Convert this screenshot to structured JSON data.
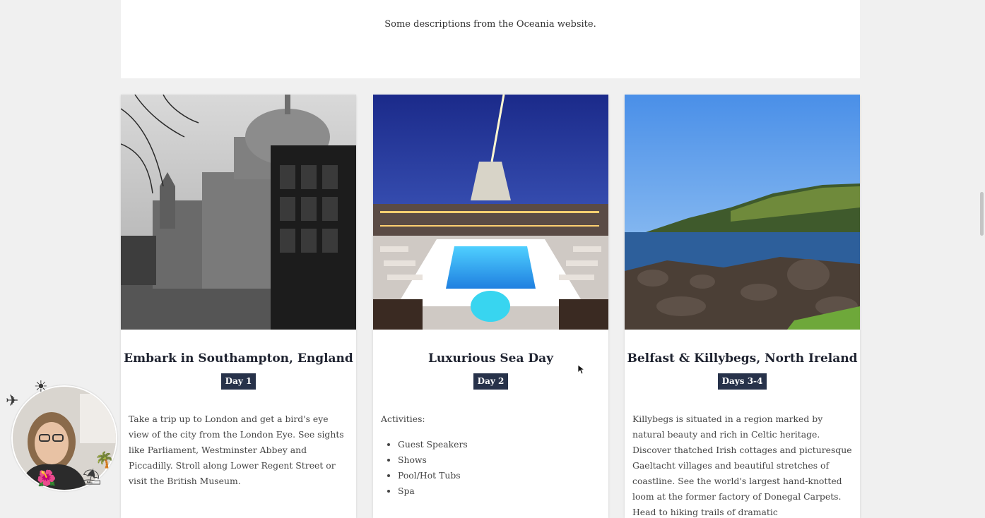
{
  "intro": {
    "text": "Some descriptions from the Oceania website."
  },
  "cards": [
    {
      "title": "Embark in Southampton, England",
      "day": "Day 1",
      "image_icon": "st-pauls-cathedral-photo",
      "body": "Take a trip up to London and get a bird's eye view of the city from the London Eye. See sights like Parliament, Westminster Abbey and Piccadilly. Stroll along Lower Regent Street or visit the British Museum."
    },
    {
      "title": "Luxurious Sea Day",
      "day": "Day 2",
      "image_icon": "cruise-ship-pool-deck-photo",
      "intro": "Activities:",
      "activities": [
        "Guest Speakers",
        "Shows",
        "Pool/Hot Tubs",
        "Spa"
      ]
    },
    {
      "title": "Belfast & Killybegs, North Ireland",
      "day": "Days 3-4",
      "image_icon": "coastal-cliffs-photo",
      "body": "Killybegs is situated in a region marked by natural beauty and rich in Celtic heritage. Discover thatched Irish cottages and picturesque Gaeltacht villages and beautiful stretches of coastline. See the world's largest hand-knotted loom at the former factory of Donegal Carpets. Head to hiking trails of dramatic"
    }
  ],
  "colors": {
    "page_bg": "#f0f0f0",
    "badge_bg": "#27324a",
    "title": "#1f2330"
  }
}
